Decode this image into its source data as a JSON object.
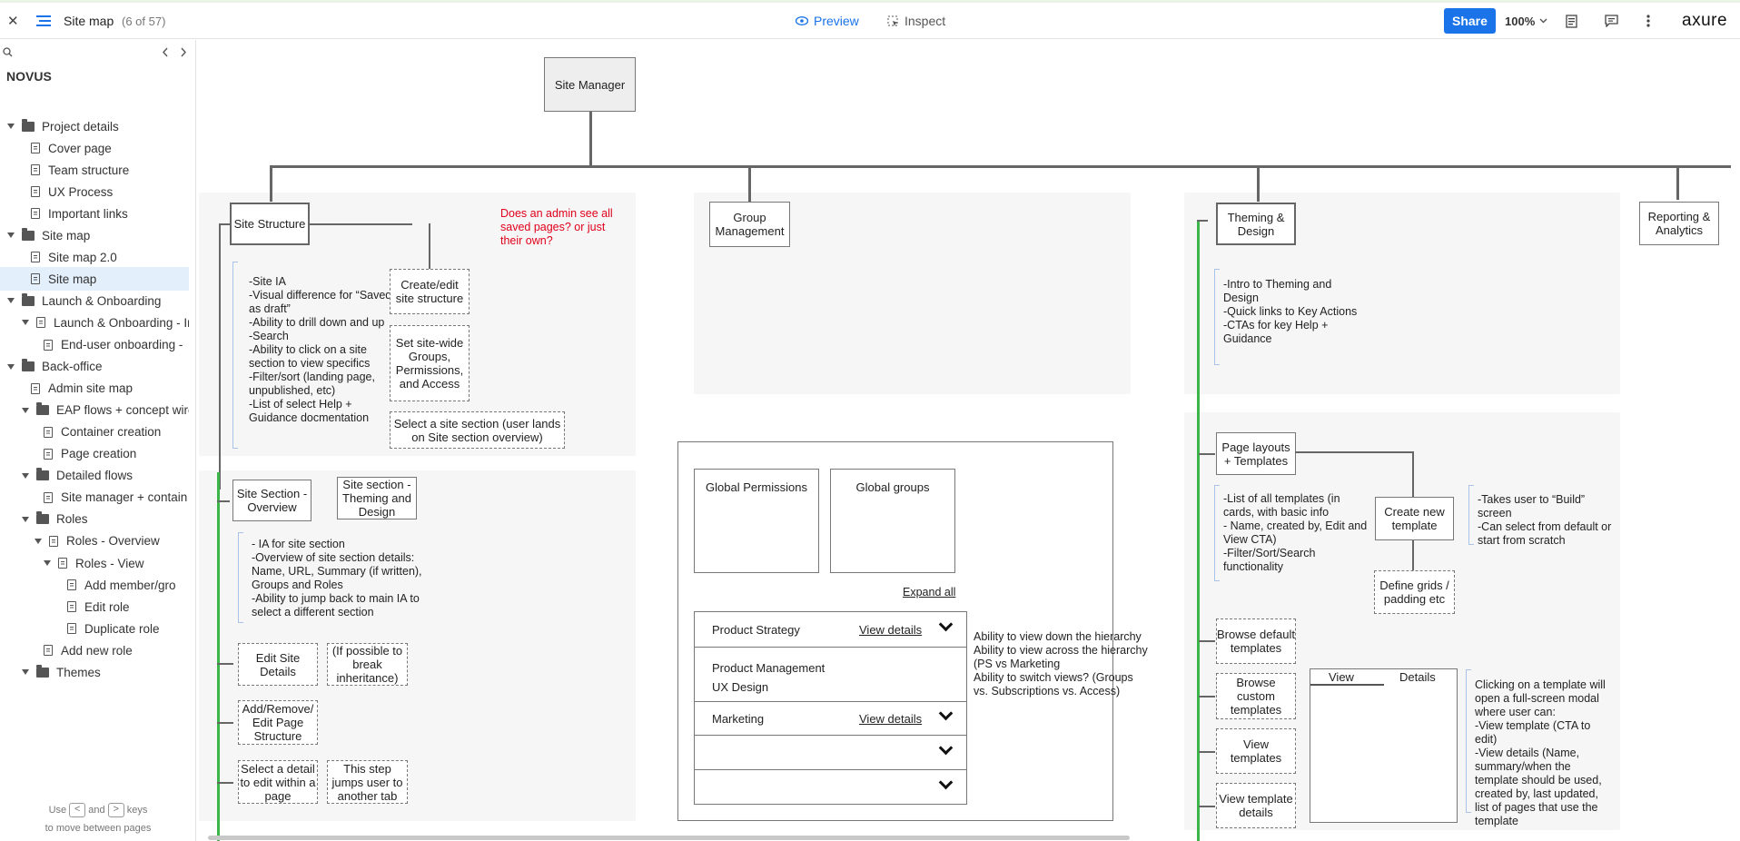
{
  "topbar": {
    "close": "✕",
    "title": "Site map",
    "count": "(6 of 57)",
    "preview": "Preview",
    "inspect": "Inspect",
    "share": "Share",
    "zoom": "100%",
    "logo": "axure"
  },
  "sidebar": {
    "project": "NOVUS",
    "items": [
      {
        "label": "Project details",
        "type": "folder"
      },
      {
        "label": "Cover page",
        "type": "page"
      },
      {
        "label": "Team structure",
        "type": "page"
      },
      {
        "label": "UX Process",
        "type": "page"
      },
      {
        "label": "Important links",
        "type": "page"
      },
      {
        "label": "Site map",
        "type": "folder"
      },
      {
        "label": "Site map 2.0",
        "type": "page"
      },
      {
        "label": "Site map",
        "type": "page",
        "selected": true
      },
      {
        "label": "Launch & Onboarding",
        "type": "folder"
      },
      {
        "label": "Launch & Onboarding - In",
        "type": "page"
      },
      {
        "label": "End-user onboarding -",
        "type": "page"
      },
      {
        "label": "Back-office",
        "type": "folder"
      },
      {
        "label": "Admin site map",
        "type": "page"
      },
      {
        "label": "EAP flows + concept wires",
        "type": "folder"
      },
      {
        "label": "Container creation",
        "type": "page"
      },
      {
        "label": "Page creation",
        "type": "page"
      },
      {
        "label": "Detailed flows",
        "type": "folder"
      },
      {
        "label": "Site manager + contain",
        "type": "page"
      },
      {
        "label": "Roles",
        "type": "folder"
      },
      {
        "label": "Roles - Overview",
        "type": "page"
      },
      {
        "label": "Roles - View",
        "type": "page"
      },
      {
        "label": "Add member/gro",
        "type": "page"
      },
      {
        "label": "Edit role",
        "type": "page"
      },
      {
        "label": "Duplicate role",
        "type": "page"
      },
      {
        "label": "Add new role",
        "type": "page"
      },
      {
        "label": "Themes",
        "type": "folder"
      }
    ],
    "footer_use": "Use",
    "footer_and": "and",
    "footer_keys": "keys",
    "footer_line2": "to move between pages"
  },
  "diagram": {
    "site_manager": "Site Manager",
    "site_structure": "Site Structure",
    "question": "Does an admin see all saved pages? or just their own?",
    "site_structure_notes": "-Site IA\n-Visual difference for “Saved as draft”\n-Ability to drill down and up\n-Search\n-Ability to click on a site section to view specifics\n-Filter/sort (landing page, unpublished, etc)\n-List of select Help + Guidance docmentation",
    "create_edit": "Create/edit site structure",
    "set_sitewide": "Set site-wide Groups, Permissions, and Access",
    "select_section": "Select a site section (user lands on Site section overview)",
    "section_overview": "Site Section - Overview",
    "section_theming": "Site section - Theming and Design",
    "section_notes": "- IA for site section\n-Overview of site section details: Name, URL, Summary (if written), Groups and Roles\n-Ability to jump back to main IA to select a different section",
    "edit_site_details": "Edit Site Details",
    "break_inheritance": "(If possible to break inheritance)",
    "add_remove": "Add/Remove/ Edit Page Structure",
    "select_detail": "Select a detail to edit within a page",
    "this_step": "This step jumps user to another tab",
    "group_management": "Group Management",
    "global_permissions": "Global Permissions",
    "global_groups": "Global groups",
    "expand_all": "Expand all",
    "rows": [
      {
        "label": "Product Strategy",
        "link": "View details"
      },
      {
        "label": "Product Management",
        "sub": "UX Design"
      },
      {
        "label": "Marketing",
        "link": "View details"
      }
    ],
    "hierarchy_notes": "Ability to view down the hierarchy\nAbility to view across the hierarchy (PS vs Marketing\nAbility to switch views? (Groups vs. Subscriptions vs. Access)",
    "theming_design": "Theming & Design",
    "theming_notes": "-Intro to Theming and Design\n-Quick links to Key Actions\n-CTAs for key Help + Guidance",
    "reporting": "Reporting & Analytics",
    "page_layouts": "Page layouts + Templates",
    "templates_notes": "-List of all templates (in cards, with basic info\n- Name, created by, Edit and View CTA)\n-Filter/Sort/Search functionality",
    "create_template": "Create new template",
    "takes_user": "-Takes user to “Build” screen\n-Can select from default or start from scratch",
    "define_grids": "Define grids / padding etc",
    "browse_default": "Browse default templates",
    "browse_custom": "Browse custom templates",
    "view_templates": "View templates",
    "view_template_details": "View template details",
    "tab_view": "View",
    "tab_details": "Details",
    "clicking_notes": "Clicking on a template will open a full-screen modal where user can:\n-View template (CTA to edit)\n-View details (Name, summary/when the template should be used, created by, last updated, list of pages that use the template"
  }
}
